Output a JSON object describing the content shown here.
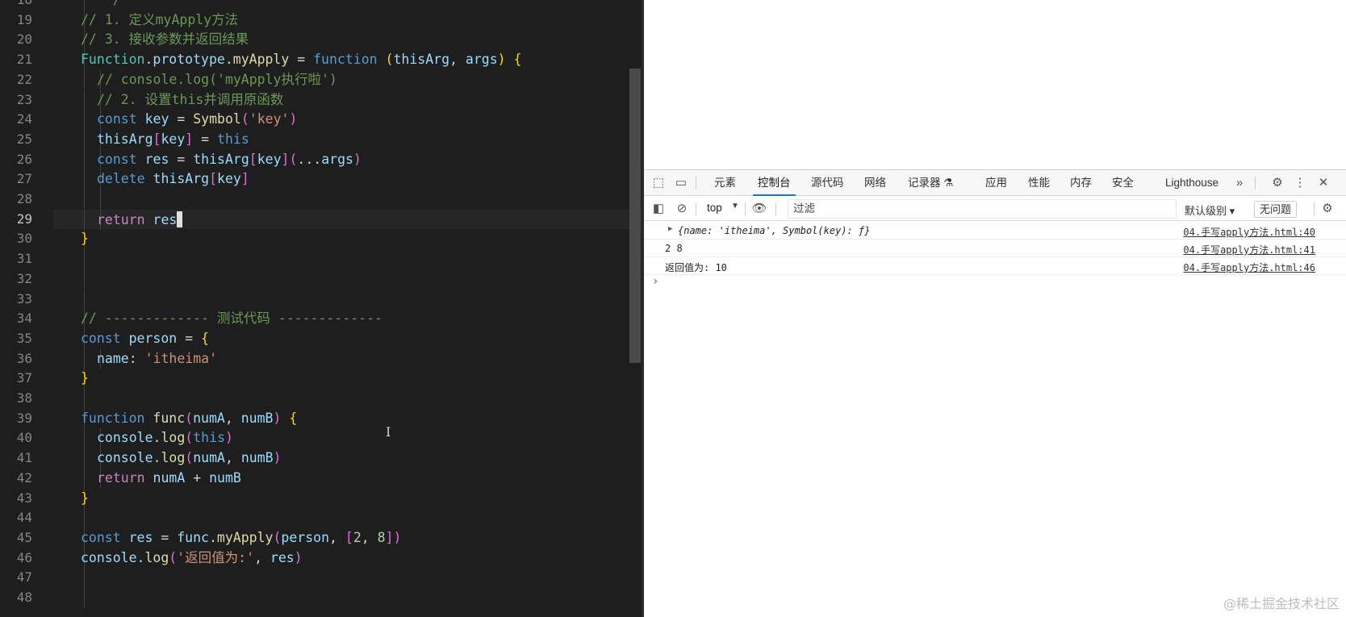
{
  "editor": {
    "colors": {
      "keyword": "#569cd6",
      "control": "#c586c0",
      "function": "#dcdcaa",
      "variable": "#9cdcfe",
      "string": "#ce9178",
      "comment": "#6a9955",
      "number": "#b5cea8",
      "type": "#4ec9b0",
      "brace": "#ffd700",
      "paren": "#da70d6",
      "plain": "#d4d4d4"
    },
    "active_line": "29",
    "lines": [
      {
        "n": "18",
        "i": 1,
        "t": [
          [
            "comment",
            " * */"
          ]
        ]
      },
      {
        "n": "19",
        "i": 1,
        "t": [
          [
            "comment",
            "// 1. 定义myApply方法"
          ]
        ]
      },
      {
        "n": "20",
        "i": 1,
        "t": [
          [
            "comment",
            "// 3. 接收参数并返回结果"
          ]
        ]
      },
      {
        "n": "21",
        "i": 1,
        "t": [
          [
            "type",
            "Function"
          ],
          [
            "plain",
            "."
          ],
          [
            "variable",
            "prototype"
          ],
          [
            "plain",
            "."
          ],
          [
            "function",
            "myApply"
          ],
          [
            "plain",
            " = "
          ],
          [
            "keyword",
            "function"
          ],
          [
            "plain",
            " "
          ],
          [
            "brace",
            "("
          ],
          [
            "variable",
            "thisArg"
          ],
          [
            "plain",
            ", "
          ],
          [
            "variable",
            "args"
          ],
          [
            "brace",
            ")"
          ],
          [
            "plain",
            " "
          ],
          [
            "brace",
            "{"
          ]
        ]
      },
      {
        "n": "22",
        "i": 2,
        "t": [
          [
            "comment",
            "// console.log('myApply执行啦')"
          ]
        ]
      },
      {
        "n": "23",
        "i": 2,
        "t": [
          [
            "comment",
            "// 2. 设置this并调用原函数"
          ]
        ]
      },
      {
        "n": "24",
        "i": 2,
        "t": [
          [
            "keyword",
            "const"
          ],
          [
            "plain",
            " "
          ],
          [
            "variable",
            "key"
          ],
          [
            "plain",
            " = "
          ],
          [
            "function",
            "Symbol"
          ],
          [
            "paren",
            "("
          ],
          [
            "string",
            "'key'"
          ],
          [
            "paren",
            ")"
          ]
        ]
      },
      {
        "n": "25",
        "i": 2,
        "t": [
          [
            "variable",
            "thisArg"
          ],
          [
            "paren",
            "["
          ],
          [
            "variable",
            "key"
          ],
          [
            "paren",
            "]"
          ],
          [
            "plain",
            " = "
          ],
          [
            "keyword",
            "this"
          ]
        ]
      },
      {
        "n": "26",
        "i": 2,
        "t": [
          [
            "keyword",
            "const"
          ],
          [
            "plain",
            " "
          ],
          [
            "variable",
            "res"
          ],
          [
            "plain",
            " = "
          ],
          [
            "variable",
            "thisArg"
          ],
          [
            "paren",
            "["
          ],
          [
            "variable",
            "key"
          ],
          [
            "paren",
            "]"
          ],
          [
            "paren",
            "("
          ],
          [
            "plain",
            "..."
          ],
          [
            "variable",
            "args"
          ],
          [
            "paren",
            ")"
          ]
        ]
      },
      {
        "n": "27",
        "i": 2,
        "t": [
          [
            "keyword",
            "delete"
          ],
          [
            "plain",
            " "
          ],
          [
            "variable",
            "thisArg"
          ],
          [
            "paren",
            "["
          ],
          [
            "variable",
            "key"
          ],
          [
            "paren",
            "]"
          ]
        ]
      },
      {
        "n": "28",
        "i": 2,
        "t": []
      },
      {
        "n": "29",
        "i": 2,
        "t": [
          [
            "control",
            "return"
          ],
          [
            "plain",
            " "
          ],
          [
            "variable",
            "res"
          ]
        ],
        "cursor": true
      },
      {
        "n": "30",
        "i": 1,
        "t": [
          [
            "brace",
            "}"
          ]
        ]
      },
      {
        "n": "31",
        "i": 1,
        "t": []
      },
      {
        "n": "32",
        "i": 1,
        "t": []
      },
      {
        "n": "33",
        "i": 1,
        "t": []
      },
      {
        "n": "34",
        "i": 1,
        "t": [
          [
            "comment",
            "// ------------- 测试代码 -------------"
          ]
        ]
      },
      {
        "n": "35",
        "i": 1,
        "t": [
          [
            "keyword",
            "const"
          ],
          [
            "plain",
            " "
          ],
          [
            "variable",
            "person"
          ],
          [
            "plain",
            " = "
          ],
          [
            "brace",
            "{"
          ]
        ]
      },
      {
        "n": "36",
        "i": 2,
        "t": [
          [
            "variable",
            "name"
          ],
          [
            "plain",
            ": "
          ],
          [
            "string",
            "'itheima'"
          ]
        ]
      },
      {
        "n": "37",
        "i": 1,
        "t": [
          [
            "brace",
            "}"
          ]
        ]
      },
      {
        "n": "38",
        "i": 1,
        "t": []
      },
      {
        "n": "39",
        "i": 1,
        "t": [
          [
            "keyword",
            "function"
          ],
          [
            "plain",
            " "
          ],
          [
            "function",
            "func"
          ],
          [
            "paren",
            "("
          ],
          [
            "variable",
            "numA"
          ],
          [
            "plain",
            ", "
          ],
          [
            "variable",
            "numB"
          ],
          [
            "paren",
            ")"
          ],
          [
            "plain",
            " "
          ],
          [
            "brace",
            "{"
          ]
        ]
      },
      {
        "n": "40",
        "i": 2,
        "t": [
          [
            "variable",
            "console"
          ],
          [
            "plain",
            "."
          ],
          [
            "function",
            "log"
          ],
          [
            "paren",
            "("
          ],
          [
            "keyword",
            "this"
          ],
          [
            "paren",
            ")"
          ]
        ]
      },
      {
        "n": "41",
        "i": 2,
        "t": [
          [
            "variable",
            "console"
          ],
          [
            "plain",
            "."
          ],
          [
            "function",
            "log"
          ],
          [
            "paren",
            "("
          ],
          [
            "variable",
            "numA"
          ],
          [
            "plain",
            ", "
          ],
          [
            "variable",
            "numB"
          ],
          [
            "paren",
            ")"
          ]
        ]
      },
      {
        "n": "42",
        "i": 2,
        "t": [
          [
            "control",
            "return"
          ],
          [
            "plain",
            " "
          ],
          [
            "variable",
            "numA"
          ],
          [
            "plain",
            " + "
          ],
          [
            "variable",
            "numB"
          ]
        ]
      },
      {
        "n": "43",
        "i": 1,
        "t": [
          [
            "brace",
            "}"
          ]
        ]
      },
      {
        "n": "44",
        "i": 1,
        "t": []
      },
      {
        "n": "45",
        "i": 1,
        "t": [
          [
            "keyword",
            "const"
          ],
          [
            "plain",
            " "
          ],
          [
            "variable",
            "res"
          ],
          [
            "plain",
            " = "
          ],
          [
            "variable",
            "func"
          ],
          [
            "plain",
            "."
          ],
          [
            "function",
            "myApply"
          ],
          [
            "paren",
            "("
          ],
          [
            "variable",
            "person"
          ],
          [
            "plain",
            ", "
          ],
          [
            "paren",
            "["
          ],
          [
            "number",
            "2"
          ],
          [
            "plain",
            ", "
          ],
          [
            "number",
            "8"
          ],
          [
            "paren",
            "]"
          ],
          [
            "paren",
            ")"
          ]
        ]
      },
      {
        "n": "46",
        "i": 1,
        "t": [
          [
            "variable",
            "console"
          ],
          [
            "plain",
            "."
          ],
          [
            "function",
            "log"
          ],
          [
            "paren",
            "("
          ],
          [
            "string",
            "'返回值为:'"
          ],
          [
            "plain",
            ", "
          ],
          [
            "variable",
            "res"
          ],
          [
            "paren",
            ")"
          ]
        ]
      },
      {
        "n": "47",
        "i": 1,
        "t": []
      },
      {
        "n": "48",
        "i": 1,
        "t": []
      }
    ]
  },
  "devtools": {
    "tabs": [
      "元素",
      "控制台",
      "源代码",
      "网络",
      "记录器 ⚗",
      "应用",
      "性能",
      "内存",
      "安全",
      "Lighthouse"
    ],
    "active_tab": "控制台",
    "more_tabs_icon": "»",
    "context_label": "top",
    "filter_placeholder": "过滤",
    "level_label": "默认级别 ▾",
    "issues_label": "无问题",
    "messages": [
      {
        "text": "{name: 'itheima', Symbol(key): ƒ}",
        "source": "04.手写apply方法.html:40",
        "expandable": true
      },
      {
        "text": "2 8",
        "source": "04.手写apply方法.html:41",
        "expandable": false
      },
      {
        "text": "返回值为: 10",
        "source": "04.手写apply方法.html:46",
        "expandable": false
      }
    ],
    "prompt": "›"
  },
  "watermark": "@稀土掘金技术社区"
}
